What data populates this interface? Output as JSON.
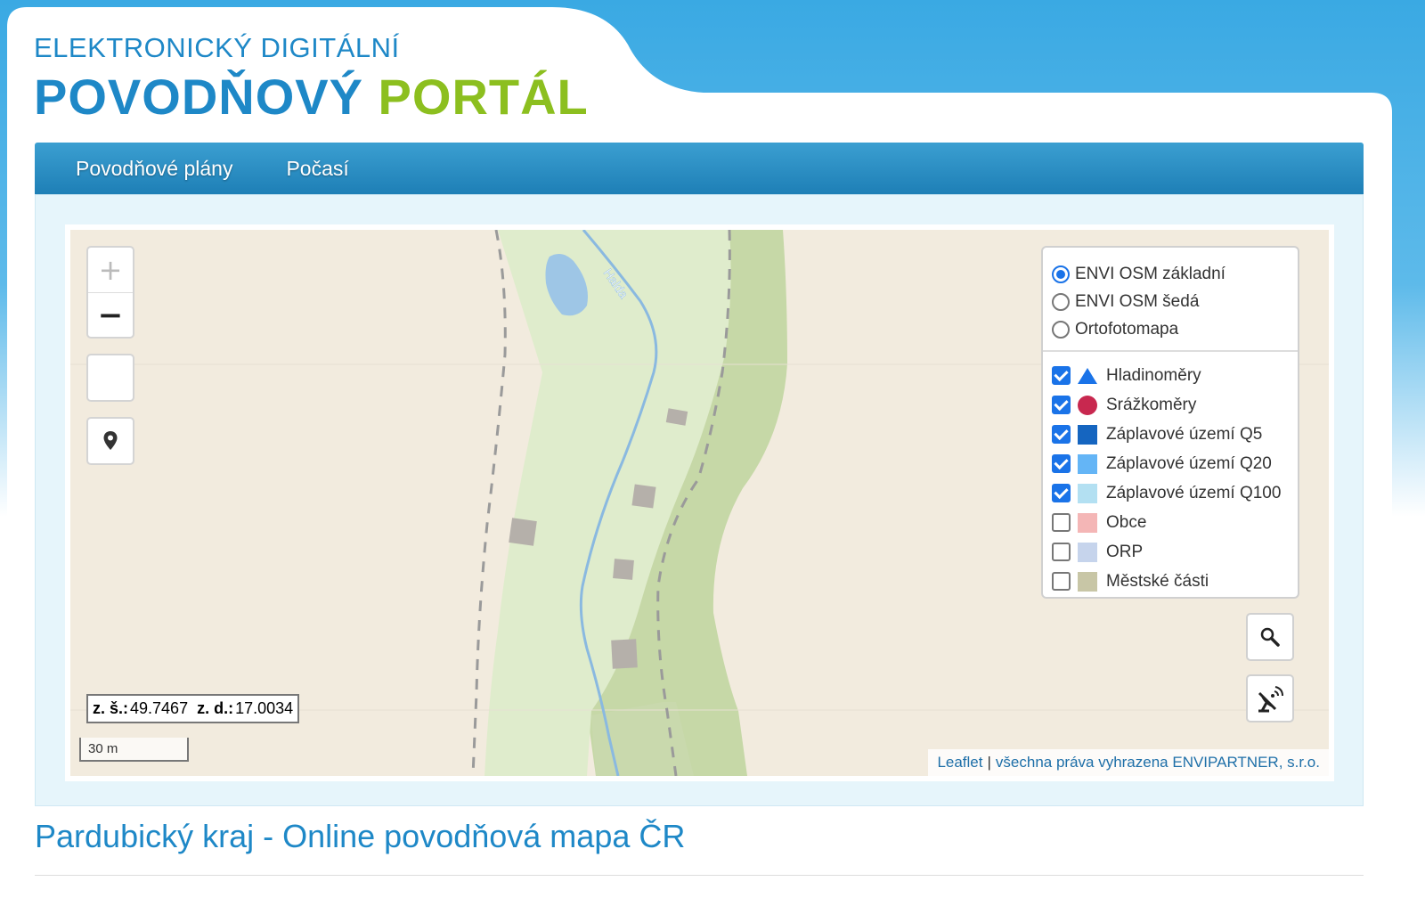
{
  "header": {
    "subtitle": "ELEKTRONICKÝ DIGITÁLNÍ",
    "title_main": "POVODŇOVÝ",
    "title_accent": "PORTÁL"
  },
  "nav": {
    "items": [
      {
        "label": "Povodňové plány"
      },
      {
        "label": "Počasí"
      }
    ]
  },
  "map": {
    "river_label": "Halda",
    "zoom_in": "+",
    "zoom_out": "−",
    "coordinates": {
      "lat_label": "z. š.:",
      "lat_value": "49.7467",
      "lon_label": "z. d.:",
      "lon_value": "17.0034"
    },
    "scale": "30 m",
    "attribution": {
      "leaflet": "Leaflet",
      "separator": "|",
      "rights": "všechna práva vyhrazena ENVIPARTNER, s.r.o."
    }
  },
  "layers": {
    "base": [
      {
        "label": "ENVI OSM základní",
        "selected": true
      },
      {
        "label": "ENVI OSM šedá",
        "selected": false
      },
      {
        "label": "Ortofotomapa",
        "selected": false
      }
    ],
    "overlays": [
      {
        "label": "Hladinoměry",
        "checked": true,
        "color": "#1a73e8",
        "symbol": "triangle"
      },
      {
        "label": "Srážkoměry",
        "checked": true,
        "color": "#c8284f",
        "symbol": "circle"
      },
      {
        "label": "Záplavové území Q5",
        "checked": true,
        "color": "#1565c0",
        "symbol": "square"
      },
      {
        "label": "Záplavové území Q20",
        "checked": true,
        "color": "#64b5f6",
        "symbol": "square"
      },
      {
        "label": "Záplavové území Q100",
        "checked": true,
        "color": "#b3e0f2",
        "symbol": "square"
      },
      {
        "label": "Obce",
        "checked": false,
        "color": "#f4b6b6",
        "symbol": "square"
      },
      {
        "label": "ORP",
        "checked": false,
        "color": "#c6d4ec",
        "symbol": "square"
      },
      {
        "label": "Městské části",
        "checked": false,
        "color": "#c8c6a6",
        "symbol": "square"
      }
    ]
  },
  "page": {
    "heading": "Pardubický kraj - Online povodňová mapa ČR"
  }
}
